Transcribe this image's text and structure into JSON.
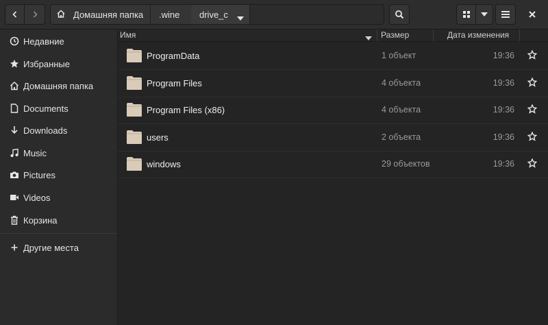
{
  "toolbar": {
    "back_icon": "chevron-left-icon",
    "forward_icon": "chevron-right-icon",
    "search_icon": "search-icon",
    "view_icon": "grid-icon",
    "view_menu_icon": "caret-down-icon",
    "menu_icon": "hamburger-icon",
    "close_icon": "close-icon"
  },
  "pathbar": {
    "crumbs": [
      "Домашняя папка",
      ".wine",
      "drive_c"
    ]
  },
  "sidebar": {
    "items": [
      {
        "label": "Недавние",
        "icon": "clock-icon"
      },
      {
        "label": "Избранные",
        "icon": "star-icon"
      },
      {
        "label": "Домашняя папка",
        "icon": "home-icon"
      },
      {
        "label": "Documents",
        "icon": "document-icon"
      },
      {
        "label": "Downloads",
        "icon": "download-icon"
      },
      {
        "label": "Music",
        "icon": "music-icon"
      },
      {
        "label": "Pictures",
        "icon": "camera-icon"
      },
      {
        "label": "Videos",
        "icon": "video-icon"
      },
      {
        "label": "Корзина",
        "icon": "trash-icon"
      }
    ],
    "other": {
      "label": "Другие места",
      "icon": "plus-icon"
    }
  },
  "columns": {
    "name": "Имя",
    "size": "Размер",
    "date": "Дата изменения"
  },
  "files": [
    {
      "name": "ProgramData",
      "size": "1 объект",
      "time": "19:36"
    },
    {
      "name": "Program Files",
      "size": "4 объекта",
      "time": "19:36"
    },
    {
      "name": "Program Files (x86)",
      "size": "4 объекта",
      "time": "19:36"
    },
    {
      "name": "users",
      "size": "2 объекта",
      "time": "19:36"
    },
    {
      "name": "windows",
      "size": "29 объектов",
      "time": "19:36"
    }
  ],
  "colors": {
    "background": "#242424",
    "sidebar": "#2b2b2b",
    "folder": "#d9cbb7"
  }
}
